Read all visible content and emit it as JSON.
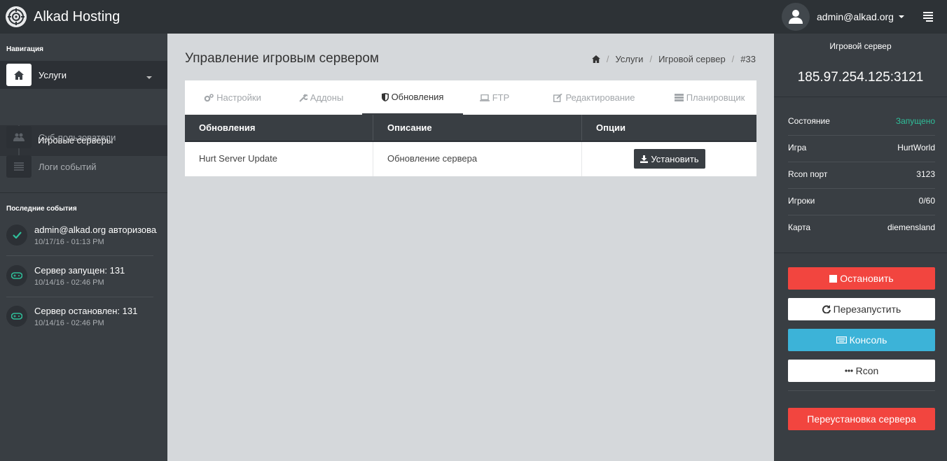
{
  "app": {
    "brand": "Alkad Hosting",
    "user": "admin@alkad.org"
  },
  "sidebar": {
    "nav_heading": "Навигация",
    "items": [
      {
        "label": "Услуги",
        "icon": "home-icon"
      },
      {
        "label": "Суб-пользователи",
        "icon": "users-icon"
      },
      {
        "label": "Логи событий",
        "icon": "list-icon"
      }
    ],
    "sub_item": "Игровые серверы",
    "events_heading": "Последние события",
    "events": [
      {
        "title": "admin@alkad.org авторизовался",
        "time": "10/17/16 - 01:13 PM",
        "icon": "check-icon"
      },
      {
        "title": "Сервер запущен: 131",
        "time": "10/14/16 - 02:46 PM",
        "icon": "gamepad-icon"
      },
      {
        "title": "Сервер остановлен: 131",
        "time": "10/14/16 - 02:46 PM",
        "icon": "gamepad-icon"
      }
    ]
  },
  "main": {
    "title": "Управление игровым сервером",
    "breadcrumb": [
      "Услуги",
      "Игровой сервер",
      "#33"
    ],
    "tabs": [
      {
        "label": "Настройки",
        "icon": "cogs-icon"
      },
      {
        "label": "Аддоны",
        "icon": "wrench-icon"
      },
      {
        "label": "Обновления",
        "icon": "shield-icon"
      },
      {
        "label": "FTP",
        "icon": "laptop-icon"
      },
      {
        "label": "Редактирование",
        "icon": "edit-icon"
      },
      {
        "label": "Планировщик",
        "icon": "server-icon"
      }
    ],
    "active_tab": "Обновления",
    "table": {
      "columns": [
        "Обновления",
        "Описание",
        "Опции"
      ],
      "rows": [
        {
          "name": "Hurt Server Update",
          "description": "Обновление сервера",
          "action": "Установить"
        }
      ]
    }
  },
  "server_panel": {
    "title": "Игровой сервер",
    "address": "185.97.254.125:3121",
    "info": [
      {
        "key": "Состояние",
        "value": "Запущено"
      },
      {
        "key": "Игра",
        "value": "HurtWorld"
      },
      {
        "key": "Rcon порт",
        "value": "3123"
      },
      {
        "key": "Игроки",
        "value": "0/60"
      },
      {
        "key": "Карта",
        "value": "diemensland"
      }
    ],
    "buttons": {
      "stop": "Остановить",
      "restart": "Перезапустить",
      "console": "Консоль",
      "rcon": "Rcon",
      "reinstall": "Переустановка сервера"
    }
  },
  "colors": {
    "status_running": "#2fbf9a",
    "danger": "#f2453f",
    "info": "#3cb3d8",
    "accent_teal": "#2fbf9a"
  }
}
